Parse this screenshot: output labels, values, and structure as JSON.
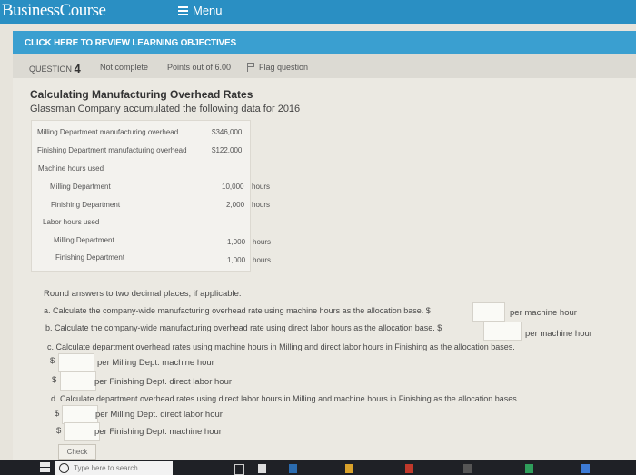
{
  "header": {
    "brand": "BusinessCourse",
    "menu_label": "Menu"
  },
  "objectives_bar": {
    "label": "CLICK HERE TO REVIEW LEARNING OBJECTIVES"
  },
  "question_header": {
    "question_label": "QUESTION",
    "question_number": "4",
    "status": "Not complete",
    "points": "Points out of 6.00",
    "flag_label": "Flag question"
  },
  "problem": {
    "title": "Calculating Manufacturing Overhead Rates",
    "subtitle": "Glassman Company accumulated the following data for 2016",
    "data": {
      "milling_overhead_label": "Milling Department manufacturing overhead",
      "milling_overhead_value": "$346,000",
      "finishing_overhead_label": "Finishing Department manufacturing overhead",
      "finishing_overhead_value": "$122,000",
      "machine_hours_label": "Machine hours used",
      "mh_milling_label": "Milling Department",
      "mh_milling_value": "10,000",
      "mh_finishing_label": "Finishing Department",
      "mh_finishing_value": "2,000",
      "labor_hours_label": "Labor hours used",
      "lh_milling_label": "Milling Department",
      "lh_milling_value": "1,000",
      "lh_finishing_label": "Finishing Department",
      "lh_finishing_value": "1,000",
      "hours_unit": "hours"
    }
  },
  "questions": {
    "round_note": "Round answers to two decimal places, if applicable.",
    "a_text": "a. Calculate the company-wide manufacturing overhead rate using machine hours as the allocation base. $",
    "a_unit": "per machine hour",
    "b_text": "b. Calculate the company-wide manufacturing overhead rate using direct labor hours as the allocation base. $",
    "b_unit": "per machine hour",
    "c_text": "c. Calculate department overhead rates using machine hours in Milling and direct labor hours in Finishing as the allocation bases.",
    "c1_unit": "per Milling Dept. machine hour",
    "c2_unit": "per Finishing Dept. direct labor hour",
    "d_text": "d. Calculate department overhead rates using direct labor hours in Milling and machine hours in Finishing as the allocation bases.",
    "d1_unit": "per Milling Dept. direct labor hour",
    "d2_unit": "per Finishing Dept. machine hour",
    "dollar": "$",
    "check_label": "Check"
  },
  "taskbar": {
    "search_placeholder": "Type here to search"
  }
}
